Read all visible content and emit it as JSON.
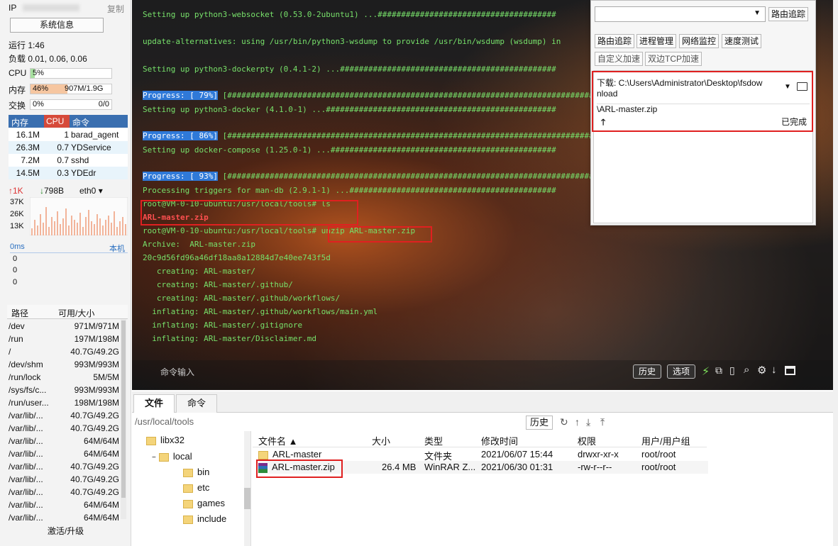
{
  "left_panel": {
    "ip_label": "IP",
    "copy_label": "复制",
    "sysinfo_button": "系统信息",
    "uptime": "运行 1:46",
    "load": "负载 0.01, 0.06, 0.06",
    "cpu_label": "CPU",
    "cpu_value": "5%",
    "cpu_fraction": 0.05,
    "mem_label": "内存",
    "mem_value": "46%",
    "mem_detail": "907M/1.9G",
    "mem_fraction": 0.46,
    "swap_label": "交换",
    "swap_value": "0%",
    "swap_detail": "0/0",
    "proc_headers": [
      "内存",
      "CPU",
      "命令"
    ],
    "processes": [
      {
        "mem": "16.1M",
        "cpu": "1",
        "cmd": "barad_agent"
      },
      {
        "mem": "26.3M",
        "cpu": "0.7",
        "cmd": "YDService"
      },
      {
        "mem": "7.2M",
        "cpu": "0.7",
        "cmd": "sshd"
      },
      {
        "mem": "14.5M",
        "cpu": "0.3",
        "cmd": "YDEdr"
      }
    ],
    "net_up": "1K",
    "net_down": "798B",
    "net_iface": "eth0",
    "net_scale": [
      "37K",
      "26K",
      "13K"
    ],
    "latency": "0ms",
    "latency_target": "本机",
    "latency_values": [
      "0",
      "0",
      "0"
    ],
    "fs_headers": [
      "路径",
      "可用/大小"
    ],
    "filesystems": [
      {
        "path": "/dev",
        "size": "971M/971M"
      },
      {
        "path": "/run",
        "size": "197M/198M"
      },
      {
        "path": "/",
        "size": "40.7G/49.2G"
      },
      {
        "path": "/dev/shm",
        "size": "993M/993M"
      },
      {
        "path": "/run/lock",
        "size": "5M/5M"
      },
      {
        "path": "/sys/fs/c...",
        "size": "993M/993M"
      },
      {
        "path": "/run/user...",
        "size": "198M/198M"
      },
      {
        "path": "/var/lib/...",
        "size": "40.7G/49.2G"
      },
      {
        "path": "/var/lib/...",
        "size": "40.7G/49.2G"
      },
      {
        "path": "/var/lib/...",
        "size": "64M/64M"
      },
      {
        "path": "/var/lib/...",
        "size": "64M/64M"
      },
      {
        "path": "/var/lib/...",
        "size": "40.7G/49.2G"
      },
      {
        "path": "/var/lib/...",
        "size": "40.7G/49.2G"
      },
      {
        "path": "/var/lib/...",
        "size": "40.7G/49.2G"
      },
      {
        "path": "/var/lib/...",
        "size": "64M/64M"
      },
      {
        "path": "/var/lib/...",
        "size": "64M/64M"
      }
    ],
    "activate_label": "激活/升级"
  },
  "terminal": {
    "lines": [
      "Setting up python3-websocket (0.53.0-2ubuntu1) ...######################################",
      "update-alternatives: using /usr/bin/python3-wsdump to provide /usr/bin/wsdump (wsdump) in",
      "Setting up python3-dockerpty (0.4.1-2) ...##############################################",
      "[###############################################################################",
      "Setting up python3-docker (4.1.0-1) ...#################################################",
      "[###############################################################################",
      "Setting up docker-compose (1.25.0-1) ...################################################",
      "[###############################################################################",
      "Processing triggers for man-db (2.9.1-1) ...############################################",
      "root@VM-0-10-ubuntu:/usr/local/tools# ls",
      "ARL-master.zip",
      "root@VM-0-10-ubuntu:/usr/local/tools# ",
      "unzip ARL-master.zip",
      "Archive:  ARL-master.zip",
      "20c9d56fd96a46df18aa8a12884d7e40ee743f5d",
      "   creating: ARL-master/",
      "   creating: ARL-master/.github/",
      "   creating: ARL-master/.github/workflows/",
      "  inflating: ARL-master/.github/workflows/main.yml",
      "  inflating: ARL-master/.gitignore",
      "  inflating: ARL-master/Disclaimer.md"
    ],
    "progress": [
      "Progress: [ 79%]",
      "Progress: [ 86%]",
      "Progress: [ 93%]"
    ],
    "cmd_input": "命令输入",
    "history_btn": "历史",
    "options_btn": "选项"
  },
  "popup": {
    "trace_btn": "路由追踪",
    "buttons": [
      "路由追踪",
      "进程管理",
      "网络监控",
      "速度测试"
    ],
    "buttons2": [
      "自定义加速",
      "双边TCP加速"
    ],
    "download_label": "下载: C:\\Users\\Administrator\\Desktop\\fsdow",
    "download_label2": "nload",
    "download_file": "\\ARL-master.zip",
    "download_status": "已完成",
    "upload_arrow": "🡑"
  },
  "bottom": {
    "tabs": [
      "文件",
      "命令"
    ],
    "path": "/usr/local/tools",
    "history": "历史",
    "tree": [
      "libx32",
      "local",
      "bin",
      "etc",
      "games",
      "include"
    ],
    "file_headers": [
      "文件名",
      "大小",
      "类型",
      "修改时间",
      "权限",
      "用户/用户组"
    ],
    "files": [
      {
        "name": "ARL-master",
        "size": "",
        "type": "文件夹",
        "mtime": "2021/06/07 15:44",
        "perm": "drwxr-xr-x",
        "owner": "root/root"
      },
      {
        "name": "ARL-master.zip",
        "size": "26.4 MB",
        "type": "WinRAR Z...",
        "mtime": "2021/06/30 01:31",
        "perm": "-rw-r--r--",
        "owner": "root/root"
      }
    ]
  },
  "colors": {
    "accent": "#3a6fb0",
    "terminal_text": "#77e06a",
    "highlight": "#e02020"
  }
}
